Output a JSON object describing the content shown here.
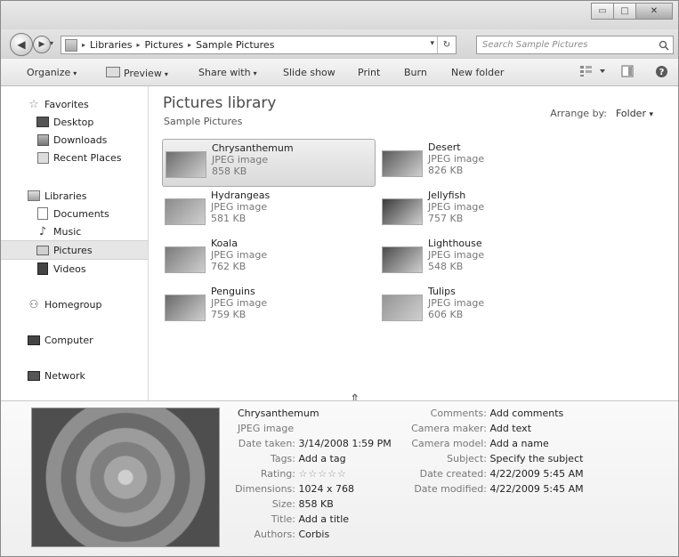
{
  "window": {
    "caption_buttons": {
      "minimize": "▭",
      "maximize": "□",
      "close": "✕"
    }
  },
  "nav": {
    "back_glyph": "◀",
    "forward_glyph": "▶",
    "dropdown_glyph": "▾",
    "breadcrumb": [
      "Libraries",
      "Pictures",
      "Sample Pictures"
    ],
    "sep_glyph": "▸",
    "refresh_glyph": "↻"
  },
  "search": {
    "placeholder": "Search Sample Pictures",
    "icon": "search-icon"
  },
  "toolbar": {
    "organize": "Organize",
    "preview": "Preview",
    "share_with": "Share with",
    "slide_show": "Slide show",
    "print": "Print",
    "burn": "Burn",
    "new_folder": "New folder",
    "arrow": "▾"
  },
  "sidebar": {
    "favorites": {
      "label": "Favorites",
      "items": [
        "Desktop",
        "Downloads",
        "Recent Places"
      ]
    },
    "libraries": {
      "label": "Libraries",
      "items": [
        "Documents",
        "Music",
        "Pictures",
        "Videos"
      ]
    },
    "homegroup": "Homegroup",
    "computer": "Computer",
    "network": "Network",
    "selected": "Pictures"
  },
  "library": {
    "title": "Pictures library",
    "subtitle": "Sample Pictures",
    "arrange_label": "Arrange by:",
    "arrange_value": "Folder",
    "arrange_arrow": "▾"
  },
  "files": [
    {
      "name": "Chrysanthemum",
      "type": "JPEG image",
      "size": "858 KB",
      "selected": true,
      "color": "#6d6d6d"
    },
    {
      "name": "Desert",
      "type": "JPEG image",
      "size": "826 KB",
      "selected": false,
      "color": "#5a5a5a"
    },
    {
      "name": "Hydrangeas",
      "type": "JPEG image",
      "size": "581 KB",
      "selected": false,
      "color": "#8b8b8b"
    },
    {
      "name": "Jellyfish",
      "type": "JPEG image",
      "size": "757 KB",
      "selected": false,
      "color": "#3a3a3a"
    },
    {
      "name": "Koala",
      "type": "JPEG image",
      "size": "762 KB",
      "selected": false,
      "color": "#7a7a7a"
    },
    {
      "name": "Lighthouse",
      "type": "JPEG image",
      "size": "548 KB",
      "selected": false,
      "color": "#4c4c4c"
    },
    {
      "name": "Penguins",
      "type": "JPEG image",
      "size": "759 KB",
      "selected": false,
      "color": "#6a6a6a"
    },
    {
      "name": "Tulips",
      "type": "JPEG image",
      "size": "606 KB",
      "selected": false,
      "color": "#959595"
    }
  ],
  "details": {
    "name": "Chrysanthemum",
    "type": "JPEG image",
    "date_taken_label": "Date taken:",
    "date_taken": "3/14/2008 1:59 PM",
    "tags_label": "Tags:",
    "tags": "Add a tag",
    "rating_label": "Rating:",
    "rating_stars": "☆☆☆☆☆",
    "rating_value": 0,
    "dimensions_label": "Dimensions:",
    "dimensions": "1024 x 768",
    "size_label": "Size:",
    "size": "858 KB",
    "title_label": "Title:",
    "title": "Add a title",
    "authors_label": "Authors:",
    "authors": "Corbis",
    "comments_label": "Comments:",
    "comments": "Add comments",
    "camera_maker_label": "Camera maker:",
    "camera_maker": "Add text",
    "camera_model_label": "Camera model:",
    "camera_model": "Add a name",
    "subject_label": "Subject:",
    "subject": "Specify the subject",
    "date_created_label": "Date created:",
    "date_created": "4/22/2009 5:45 AM",
    "date_modified_label": "Date modified:",
    "date_modified": "4/22/2009 5:45 AM"
  },
  "splitter_glyph": "⇕"
}
